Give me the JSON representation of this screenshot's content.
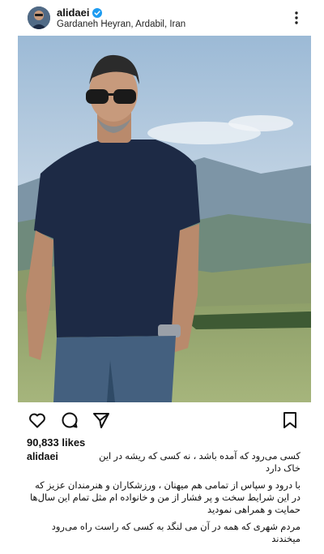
{
  "post": {
    "username": "alidaei",
    "location": "Gardaneh Heyran, Ardabil, Iran",
    "likes": "90,833 likes",
    "caption": {
      "line1": "کسی می‌رود که آمده باشد ، نه کسی که ریشه در این خاک دارد",
      "para1": "با درود و سپاس از تمامی هم میهنان ، ورزشکاران و هنرمندان عزیز که در این شرایط سخت و پر فشار از من و خانواده ام  مثل تمام این سال‌ها حمایت و همراهی نمودید",
      "para2": "مردم شهری که همه در آن می لنگد به کسی که راست راه می‌رود میخندند"
    }
  },
  "icons": {
    "verified": "verified-badge-icon",
    "more": "more-options-icon",
    "like": "heart-icon",
    "comment": "comment-icon",
    "share": "share-icon",
    "save": "bookmark-icon"
  },
  "colors": {
    "verified": "#1d9bf0",
    "text": "#111111"
  }
}
